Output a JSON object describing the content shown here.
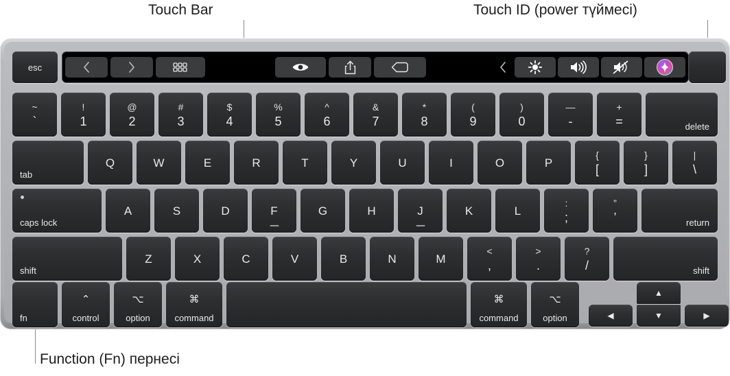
{
  "callouts": {
    "touch_bar": "Touch Bar",
    "touch_id": "Touch ID (power түймесі)",
    "fn": "Function (Fn) пернесі"
  },
  "colors": {
    "chassis": "#b2b3b6",
    "key": "#2d2e30",
    "key_text": "#e9eaec",
    "touchbar_bg": "#000000",
    "touchbar_button": "#3b3c3e",
    "leader_line": "#8a8a8e"
  },
  "touch_bar": {
    "esc_label": "esc",
    "buttons": [
      {
        "icon": "chevron-left-icon",
        "label": "back"
      },
      {
        "icon": "chevron-right-icon",
        "label": "forward"
      },
      {
        "icon": "grid-icon",
        "label": "tab-overview"
      },
      {
        "icon": "eye-icon",
        "label": "preview"
      },
      {
        "icon": "share-icon",
        "label": "share"
      },
      {
        "icon": "tag-icon",
        "label": "tag"
      }
    ],
    "control_strip": {
      "expand_icon": "chevron-left-icon",
      "items": [
        {
          "icon": "brightness-icon",
          "label": "brightness"
        },
        {
          "icon": "volume-up-icon",
          "label": "volume"
        },
        {
          "icon": "volume-mute-icon",
          "label": "mute"
        },
        {
          "icon": "siri-icon",
          "label": "siri"
        }
      ]
    },
    "touch_id_label": ""
  },
  "rows": {
    "numbers": [
      {
        "top": "~",
        "bot": "`"
      },
      {
        "top": "!",
        "bot": "1"
      },
      {
        "top": "@",
        "bot": "2"
      },
      {
        "top": "#",
        "bot": "3"
      },
      {
        "top": "$",
        "bot": "4"
      },
      {
        "top": "%",
        "bot": "5"
      },
      {
        "top": "^",
        "bot": "6"
      },
      {
        "top": "&",
        "bot": "7"
      },
      {
        "top": "*",
        "bot": "8"
      },
      {
        "top": "(",
        "bot": "9"
      },
      {
        "top": ")",
        "bot": "0"
      },
      {
        "top": "—",
        "bot": "-"
      },
      {
        "top": "+",
        "bot": "="
      }
    ],
    "delete_label": "delete",
    "tab_label": "tab",
    "qwerty": [
      "Q",
      "W",
      "E",
      "R",
      "T",
      "Y",
      "U",
      "I",
      "O",
      "P"
    ],
    "brackets": [
      {
        "top": "{",
        "bot": "["
      },
      {
        "top": "}",
        "bot": "]"
      },
      {
        "top": "|",
        "bot": "\\"
      }
    ],
    "caps_lock_label": "caps lock",
    "home": [
      "A",
      "S",
      "D",
      "F",
      "G",
      "H",
      "J",
      "K",
      "L"
    ],
    "home_punct": [
      {
        "top": ":",
        "bot": ";"
      },
      {
        "top": "”",
        "bot": "’"
      }
    ],
    "return_label": "return",
    "shift_left_label": "shift",
    "shift_right_label": "shift",
    "zxcv": [
      "Z",
      "X",
      "C",
      "V",
      "B",
      "N",
      "M"
    ],
    "bottom_punct": [
      {
        "top": "<",
        "bot": ","
      },
      {
        "top": ">",
        "bot": "."
      },
      {
        "top": "?",
        "bot": "/"
      }
    ],
    "modifiers_left": [
      {
        "sym": "",
        "word": "fn"
      },
      {
        "sym": "⌃",
        "word": "control"
      },
      {
        "sym": "⌥",
        "word": "option"
      },
      {
        "sym": "⌘",
        "word": "command"
      }
    ],
    "modifiers_right": [
      {
        "sym": "⌘",
        "word": "command"
      },
      {
        "sym": "⌥",
        "word": "option"
      }
    ],
    "arrows": {
      "up": "▲",
      "down": "▼",
      "left": "◀",
      "right": "▶"
    },
    "space_label": ""
  }
}
